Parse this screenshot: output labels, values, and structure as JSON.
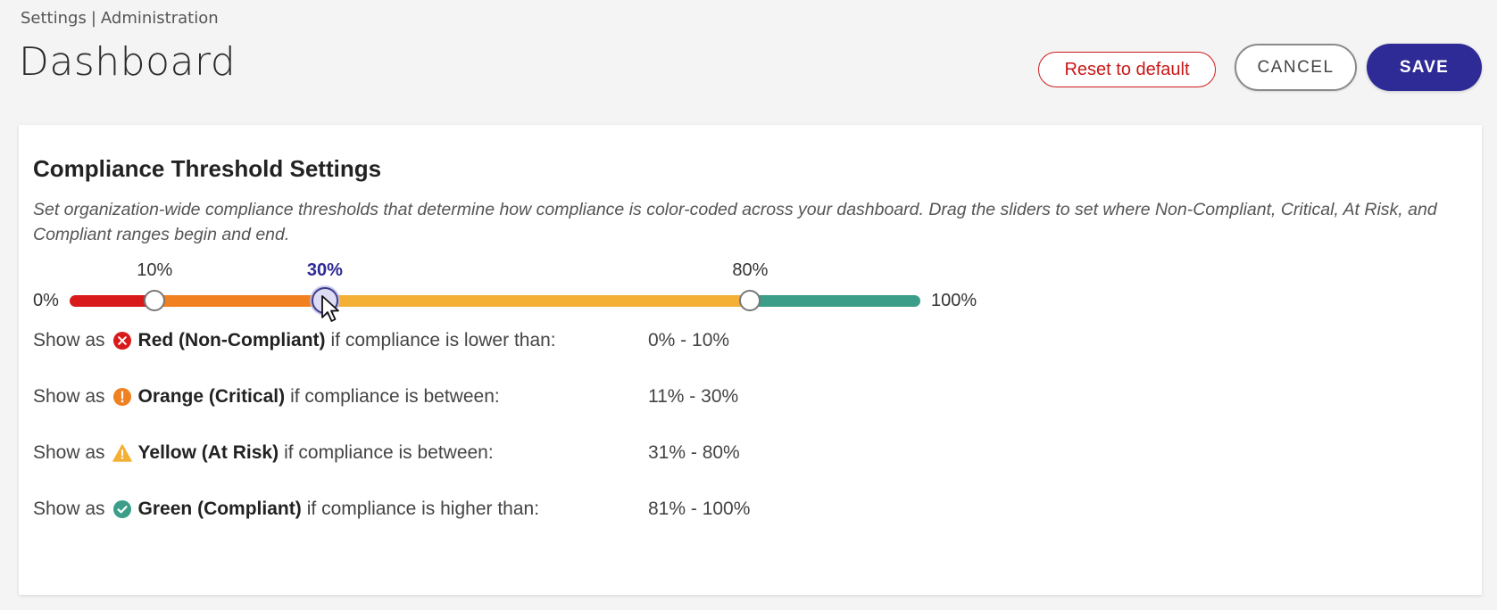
{
  "breadcrumb": {
    "section": "Settings",
    "separator": "|",
    "page": "Administration"
  },
  "page_title": "Dashboard",
  "actions": {
    "reset_label": "Reset to default",
    "cancel_label": "CANCEL",
    "save_label": "SAVE"
  },
  "colors": {
    "brand": "#2e2a96",
    "red": "#d91a1a",
    "orange": "#f08020",
    "yellow": "#f3b035",
    "green": "#3a9e88"
  },
  "card": {
    "title": "Compliance Threshold Settings",
    "description": "Set organization-wide compliance thresholds that determine how compliance is color-coded across your dashboard. Drag the sliders to set where Non-Compliant, Critical, At Risk, and Compliant ranges begin and end."
  },
  "slider": {
    "min_label": "0%",
    "max_label": "100%",
    "handles": [
      {
        "label": "10%",
        "value": 10,
        "active": false
      },
      {
        "label": "30%",
        "value": 30,
        "active": true
      },
      {
        "label": "80%",
        "value": 80,
        "active": false
      }
    ]
  },
  "rules": [
    {
      "prefix": "Show as",
      "icon": "x-circle-icon",
      "color_name": "Red (Non-Compliant)",
      "condition": "if compliance is lower than:",
      "range": "0% - 10%"
    },
    {
      "prefix": "Show as",
      "icon": "exclamation-circle-icon",
      "color_name": "Orange (Critical)",
      "condition": "if compliance is between:",
      "range": "11% - 30%"
    },
    {
      "prefix": "Show as",
      "icon": "warning-triangle-icon",
      "color_name": "Yellow (At Risk)",
      "condition": "if compliance is between:",
      "range": "31% - 80%"
    },
    {
      "prefix": "Show as",
      "icon": "check-circle-icon",
      "color_name": "Green (Compliant)",
      "condition": "if compliance is higher than:",
      "range": "81% - 100%"
    }
  ]
}
